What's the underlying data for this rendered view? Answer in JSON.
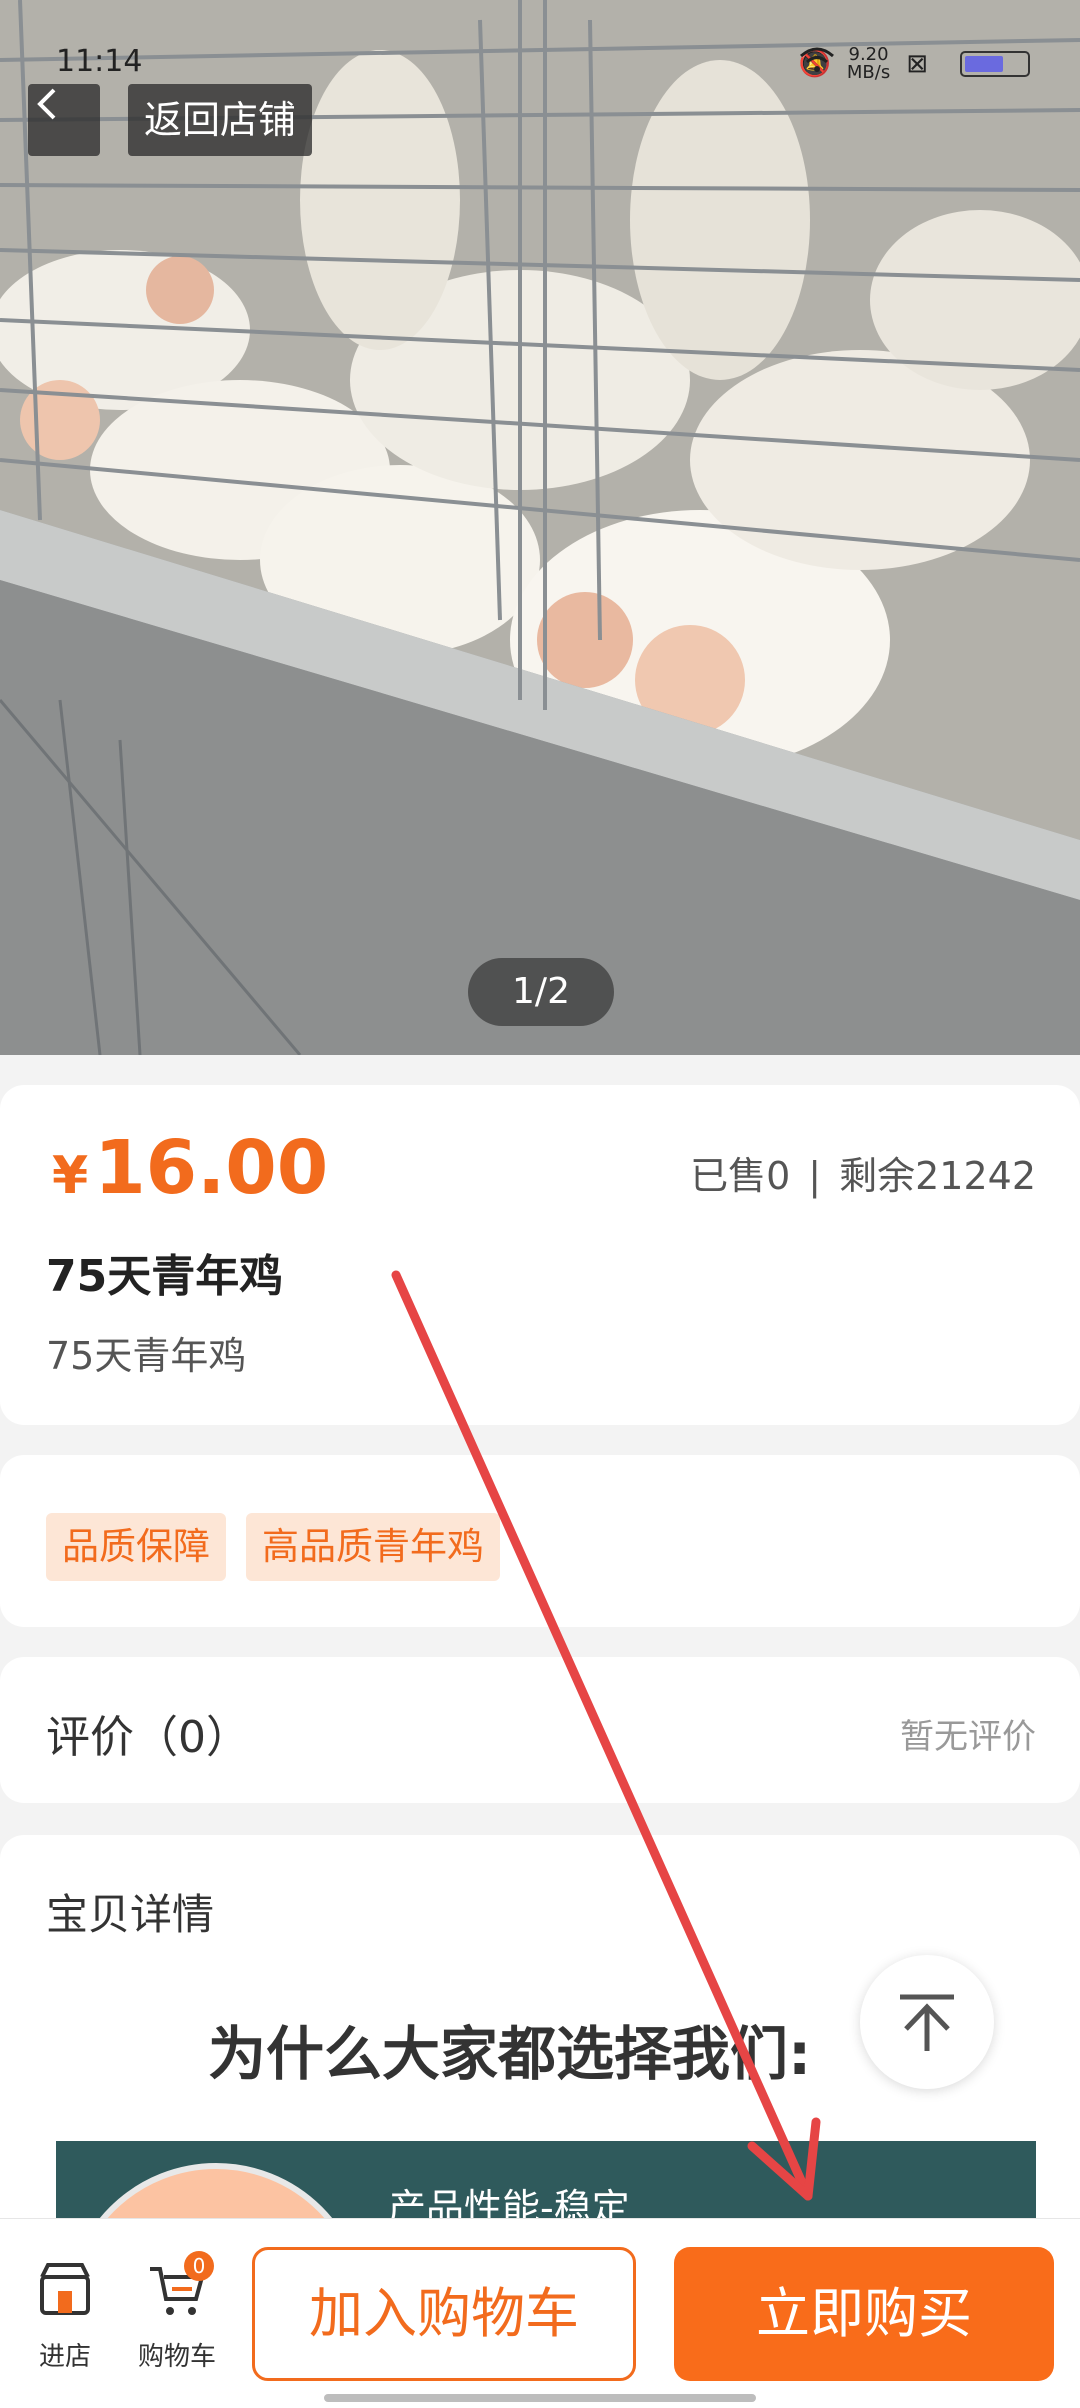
{
  "status_bar": {
    "time": "11:14",
    "net_speed": "9.20",
    "net_unit": "MB/s"
  },
  "nav": {
    "back_label": "返回店铺"
  },
  "gallery": {
    "pager": "1/2"
  },
  "product": {
    "currency": "¥",
    "price": "16.00",
    "sold": "已售0",
    "separator": "|",
    "remaining": "剩余21242",
    "title": "75天青年鸡",
    "subtitle": "75天青年鸡"
  },
  "tags": [
    "品质保障",
    "高品质青年鸡"
  ],
  "review": {
    "title": "评价（0）",
    "empty": "暂无评价"
  },
  "detail": {
    "title": "宝贝详情",
    "heading": "为什么大家都选择我们:",
    "banner_text": "产品性能-稳定"
  },
  "bottom_bar": {
    "store_label": "进店",
    "cart_label": "购物车",
    "cart_count": "0",
    "add_to_cart": "加入购物车",
    "buy_now": "立即购买"
  },
  "colors": {
    "accent": "#f26b1d",
    "annotation_arrow": "#e64545"
  }
}
